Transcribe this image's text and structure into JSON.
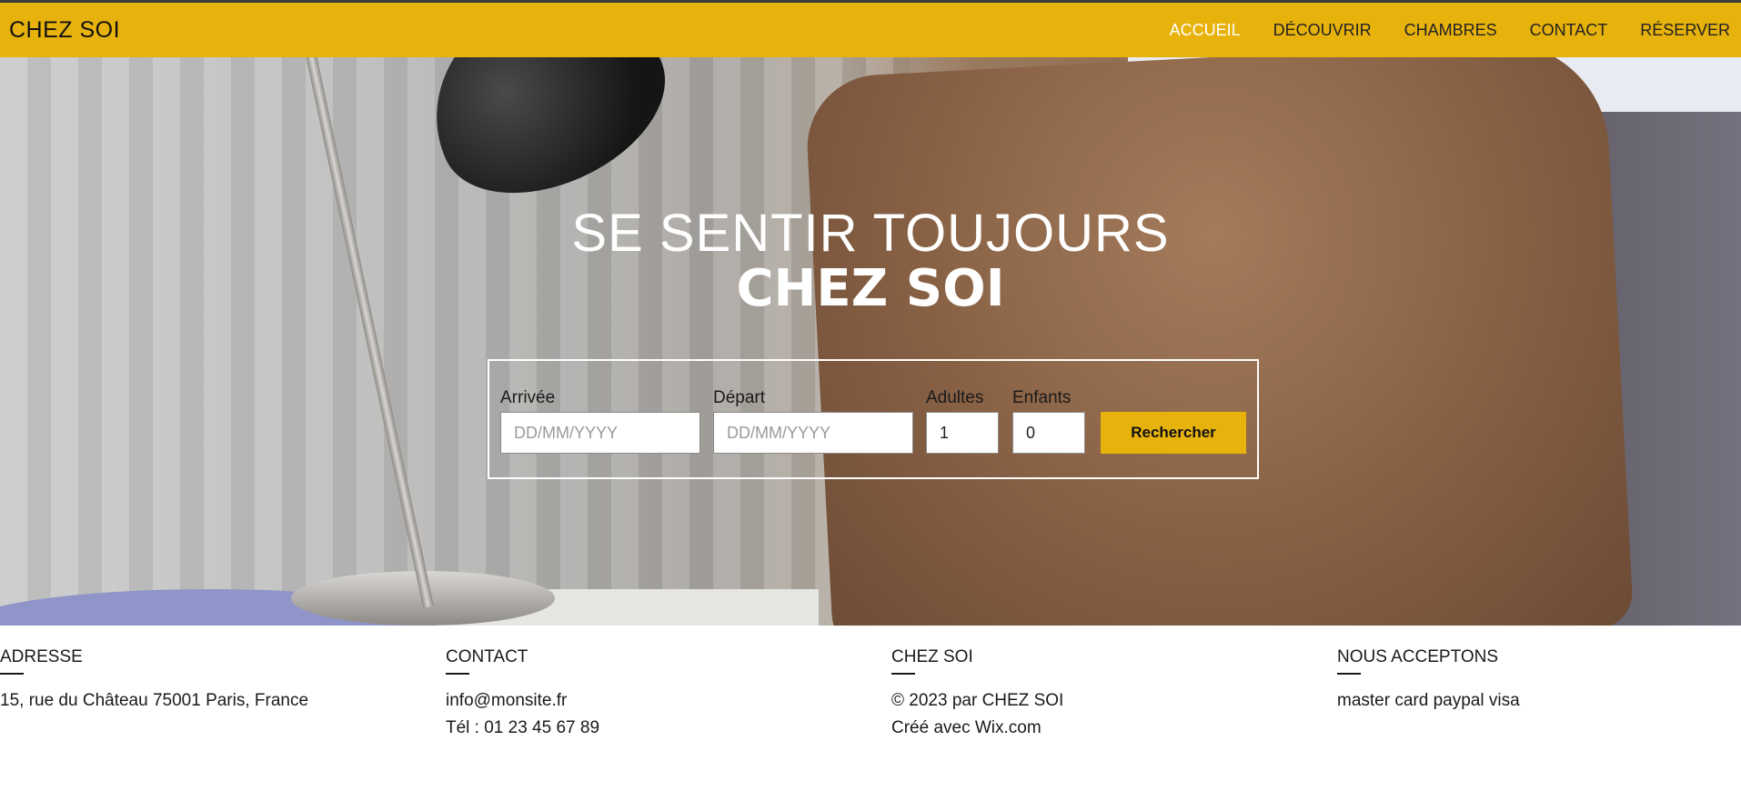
{
  "header": {
    "logo": "CHEZ SOI",
    "nav": [
      {
        "label": "ACCUEIL",
        "active": true
      },
      {
        "label": "DÉCOUVRIR",
        "active": false
      },
      {
        "label": "CHAMBRES",
        "active": false
      },
      {
        "label": "CONTACT",
        "active": false
      },
      {
        "label": "RÉSERVER",
        "active": false
      }
    ]
  },
  "hero": {
    "title_line1": "SE SENTIR TOUJOURS",
    "title_line2": "CHEZ SOI"
  },
  "search": {
    "arrival": {
      "label": "Arrivée",
      "placeholder": "DD/MM/YYYY",
      "value": ""
    },
    "departure": {
      "label": "Départ",
      "placeholder": "DD/MM/YYYY",
      "value": ""
    },
    "adults": {
      "label": "Adultes",
      "value": "1"
    },
    "children": {
      "label": "Enfants",
      "value": "0"
    },
    "button_label": "Rechercher"
  },
  "footer": {
    "address": {
      "title": "ADRESSE",
      "line1": "15, rue du Château 75001 Paris, France"
    },
    "contact": {
      "title": "CONTACT",
      "email": "info@monsite.fr",
      "phone": "Tél : 01 23 45 67 89"
    },
    "about": {
      "title": "CHEZ SOI",
      "line1": "© 2023 par CHEZ SOI",
      "line2": "Créé avec Wix.com"
    },
    "payment": {
      "title": "NOUS ACCEPTONS",
      "line1": "master card paypal visa"
    }
  },
  "colors": {
    "accent": "#e8b20c",
    "hero_text": "#ffffff",
    "text": "#1a1a1a"
  }
}
